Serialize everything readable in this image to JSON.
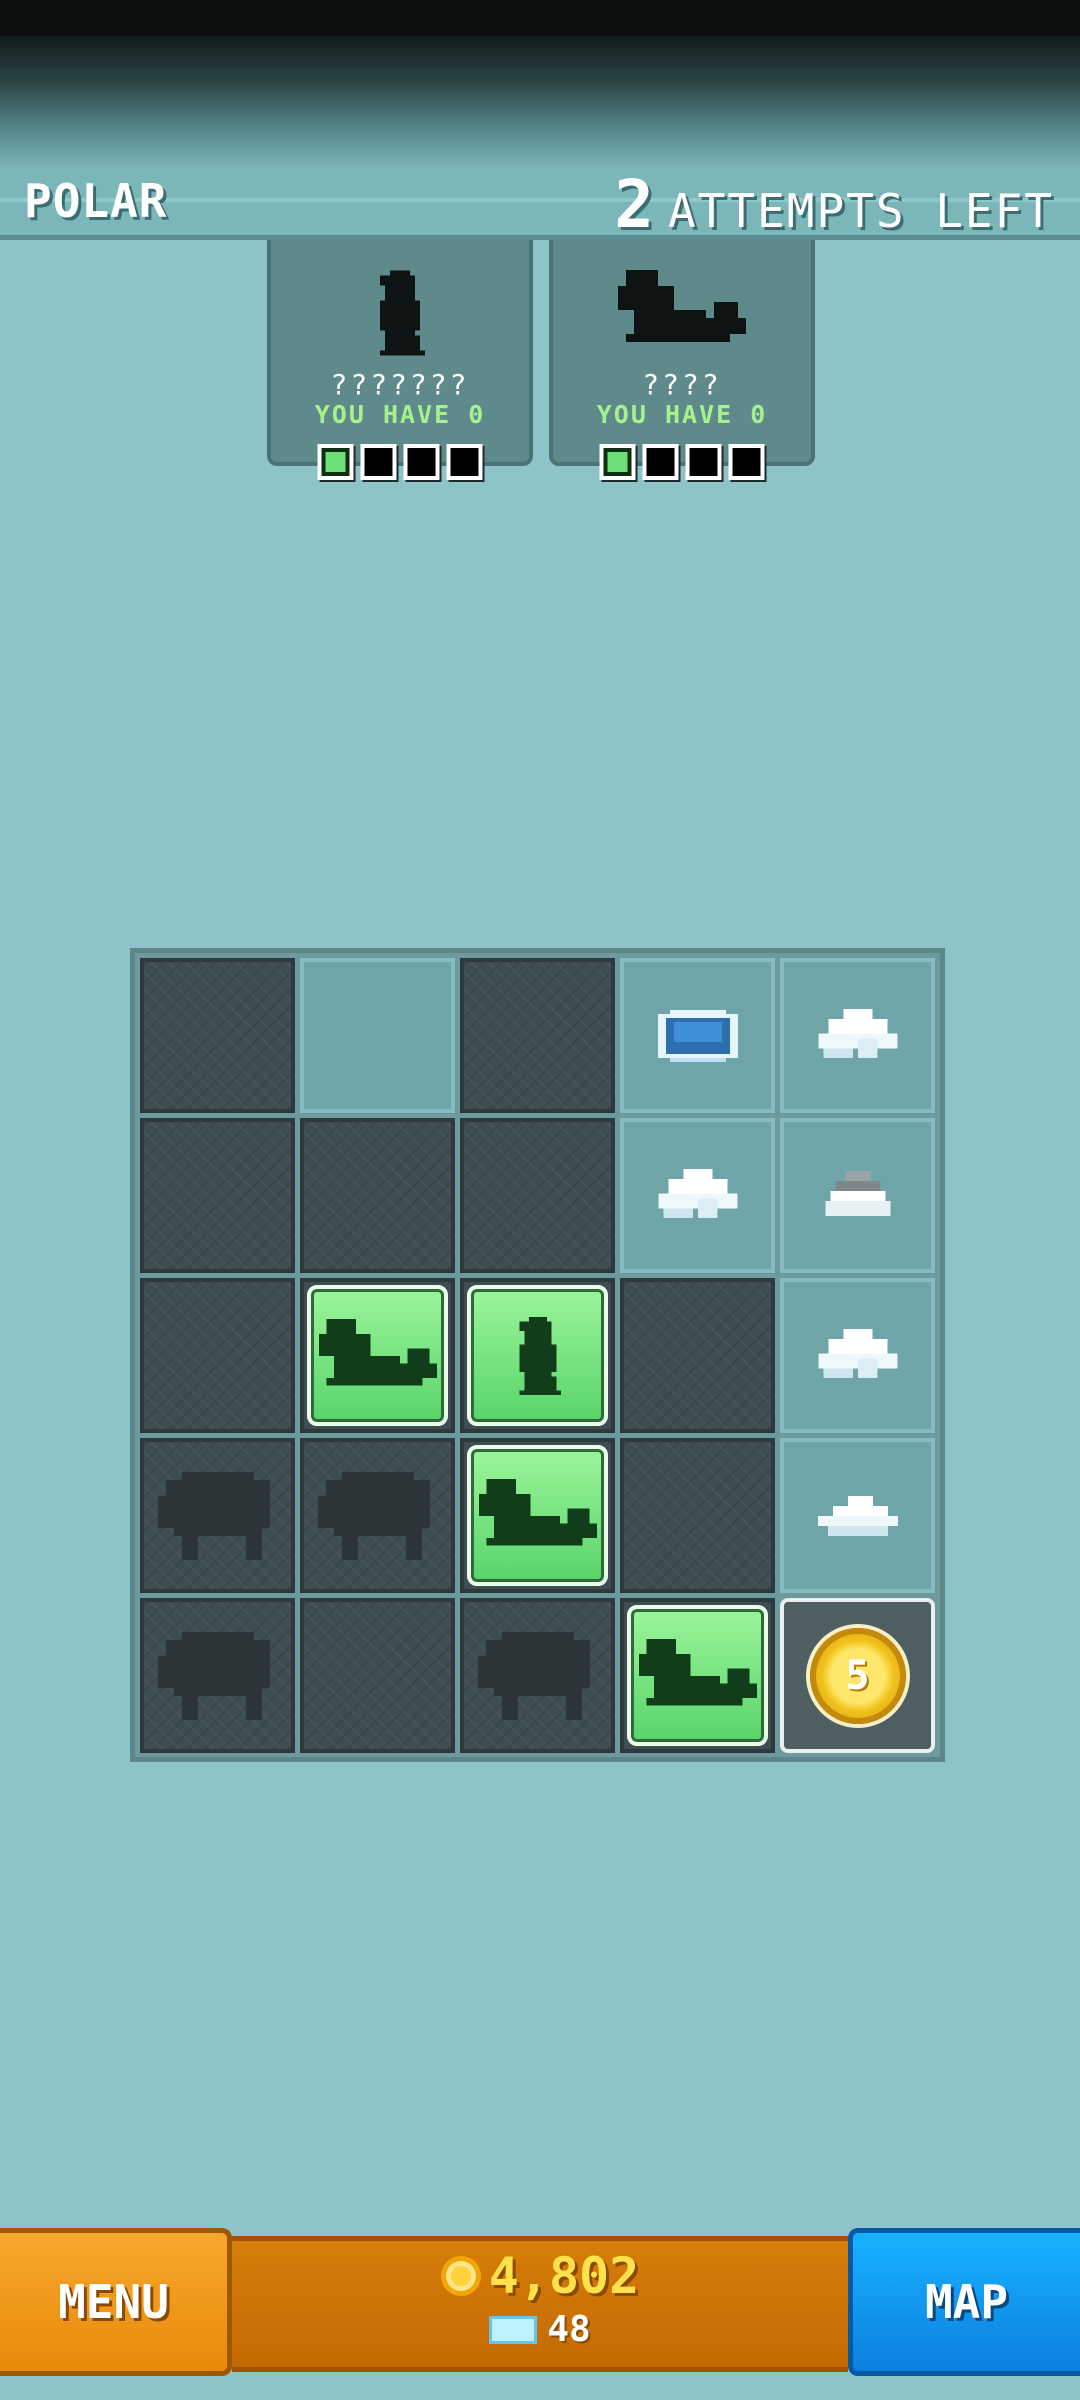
{
  "header": {
    "region": "POLAR",
    "attempts_count": "2",
    "attempts_label": "ATTEMPTS LEFT"
  },
  "targets": [
    {
      "icon": "penguin-silhouette-icon",
      "name": "???????",
      "have": "YOU HAVE 0",
      "progress": 1,
      "total": 4
    },
    {
      "icon": "seal-silhouette-icon",
      "name": "????",
      "have": "YOU HAVE 0",
      "progress": 1,
      "total": 4
    }
  ],
  "grid": {
    "rows": [
      [
        "hidden",
        "revealed-empty",
        "hidden",
        "revealed-ice-hole",
        "revealed-snow"
      ],
      [
        "hidden",
        "hidden",
        "hidden",
        "revealed-snow",
        "revealed-rock"
      ],
      [
        "hidden",
        "found-seal",
        "found-penguin",
        "hidden",
        "revealed-snow"
      ],
      [
        "hidden-muskox",
        "hidden-muskox",
        "found-seal",
        "hidden",
        "revealed-snowdrift"
      ],
      [
        "hidden-muskox",
        "hidden",
        "hidden-muskox",
        "found-seal",
        "coin"
      ]
    ],
    "coin_value": "5"
  },
  "bottom": {
    "menu_label": "MENU",
    "coins": "4,802",
    "gems": "48",
    "map_label": "MAP"
  },
  "colors": {
    "background": "#8ec3c7",
    "menu": "#f09a1b",
    "map": "#0f99f0",
    "found": "#6ee07a"
  }
}
